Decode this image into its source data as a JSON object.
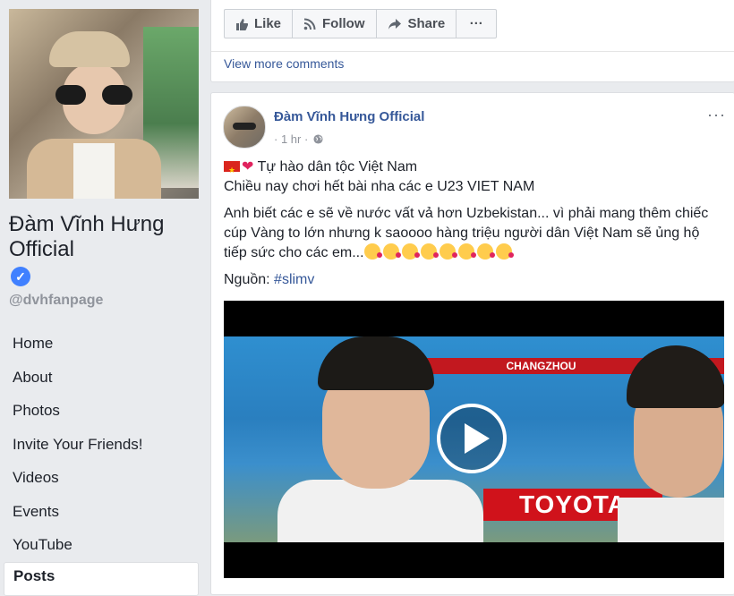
{
  "page": {
    "name": "Đàm Vĩnh Hưng Official",
    "handle": "@dvhfanpage"
  },
  "nav": {
    "items": [
      {
        "label": "Home"
      },
      {
        "label": "About"
      },
      {
        "label": "Photos"
      },
      {
        "label": "Invite Your Friends!"
      },
      {
        "label": "Videos"
      },
      {
        "label": "Events"
      },
      {
        "label": "YouTube"
      },
      {
        "label": "Posts"
      }
    ],
    "active": "Posts"
  },
  "top_card": {
    "like_label": "Like",
    "follow_label": "Follow",
    "share_label": "Share",
    "more_label": "···",
    "view_more_comments": "View more comments"
  },
  "post": {
    "author": "Đàm Vĩnh Hưng Official",
    "time": "· 1 hr ·",
    "more_label": "···",
    "line1": "Tự hào dân tộc Việt Nam",
    "line2": "Chiều nay chơi hết bài nha các e U23 VIET NAM",
    "line3": "Anh biết các e sẽ về nước vất vả hơn Uzbekistan... vì phải mang thêm chiếc cúp Vàng to lớn nhưng k saoooo hàng triệu người dân Việt Nam sẽ ủng hộ tiếp sức cho các em...",
    "source_label": "Nguồn:",
    "source_tag": "#slimv",
    "video": {
      "banner_text": "CHANGZHOU",
      "sponsor_text": "TOYOTA"
    }
  },
  "colors": {
    "link": "#365899",
    "background": "#e9ebee",
    "verified": "#4080ff"
  },
  "icons": {
    "like": "thumbs-up-icon",
    "follow": "rss-icon",
    "share": "share-arrow-icon",
    "verified": "checkmark-badge-icon",
    "globe": "globe-icon",
    "play": "play-icon"
  }
}
